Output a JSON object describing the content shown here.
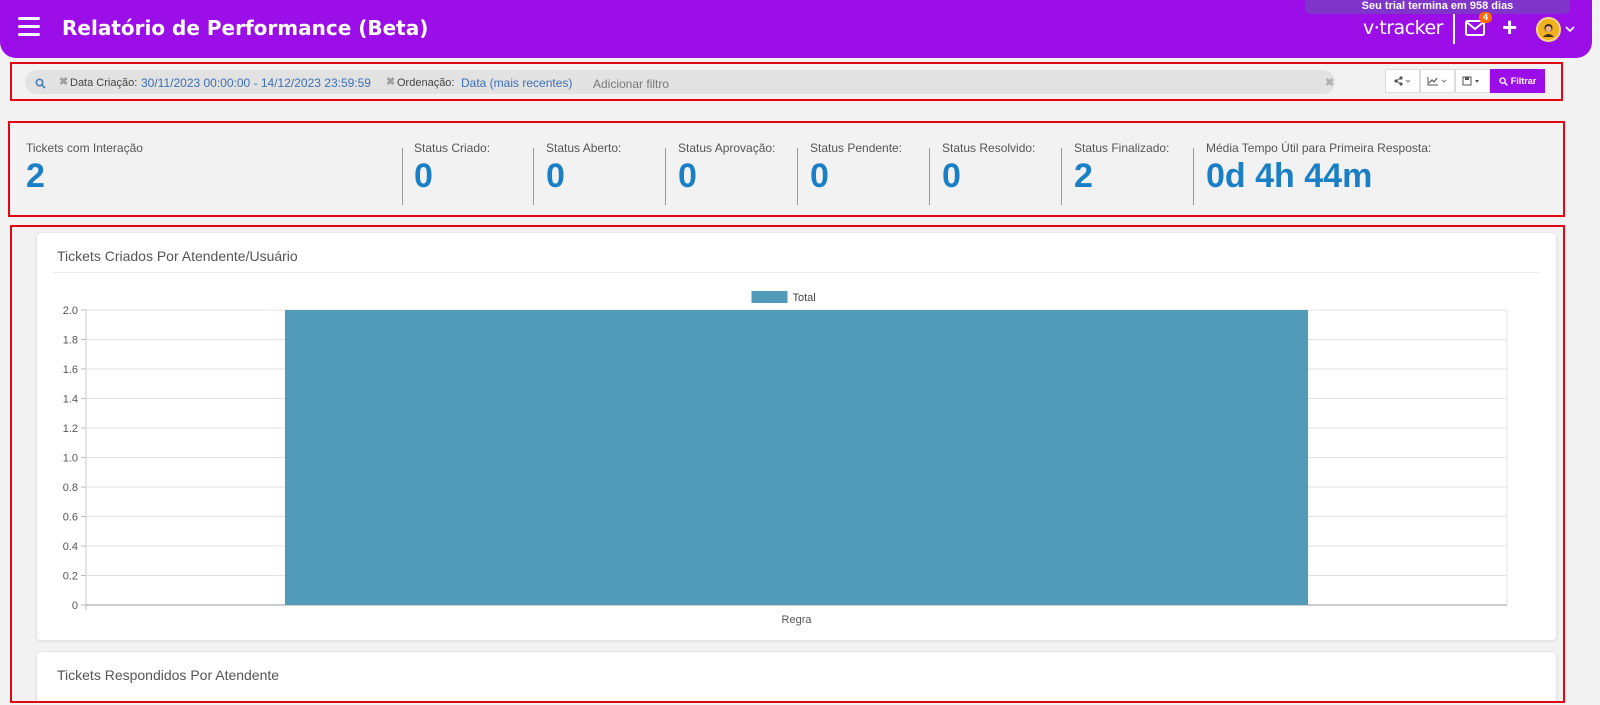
{
  "header": {
    "title": "Relatório de Performance (Beta)",
    "trial_text": "Seu trial termina em 958 dias",
    "brand": "v·tracker",
    "mail_badge": "4",
    "plus_label": "+",
    "menu_icon": "hamburger-icon",
    "mail_icon": "envelope-icon",
    "avatar_icon": "user-avatar",
    "colors": {
      "header_bg": "#9b0ee8",
      "trial_bg": "#7f35c9",
      "badge_bg": "#ff6a00"
    }
  },
  "filters": {
    "items": [
      {
        "label": "Data Criação:",
        "value": "30/11/2023 00:00:00 - 14/12/2023 23:59:59"
      },
      {
        "label": "Ordenação:",
        "value": "Data (mais recentes)"
      }
    ],
    "add_filter": "Adicionar filtro",
    "filter_button": "Filtrar",
    "tools": [
      "share-icon",
      "line-chart-icon",
      "save-icon"
    ]
  },
  "stats": [
    {
      "label": "Tickets com Interação",
      "value": "2"
    },
    {
      "label": "Status Criado:",
      "value": "0"
    },
    {
      "label": "Status Aberto:",
      "value": "0"
    },
    {
      "label": "Status Aprovação:",
      "value": "0"
    },
    {
      "label": "Status Pendente:",
      "value": "0"
    },
    {
      "label": "Status Resolvido:",
      "value": "0"
    },
    {
      "label": "Status Finalizado:",
      "value": "2"
    },
    {
      "label": "Média Tempo Útil para Primeira Resposta:",
      "value": "0d 4h 44m"
    }
  ],
  "panels": {
    "created_title": "Tickets Criados Por Atendente/Usuário",
    "responded_title": "Tickets Respondidos Por Atendente"
  },
  "chart_data": {
    "type": "bar",
    "categories": [
      "Regra"
    ],
    "series": [
      {
        "name": "Total",
        "values": [
          2
        ],
        "color": "#529bb8"
      }
    ],
    "ylim": [
      0,
      2.0
    ],
    "yticks": [
      "2.0",
      "1.8",
      "1.6",
      "1.4",
      "1.2",
      "1.0",
      "0.8",
      "0.6",
      "0.4",
      "0.2",
      "0"
    ],
    "grid": true,
    "legend": "top-center"
  }
}
